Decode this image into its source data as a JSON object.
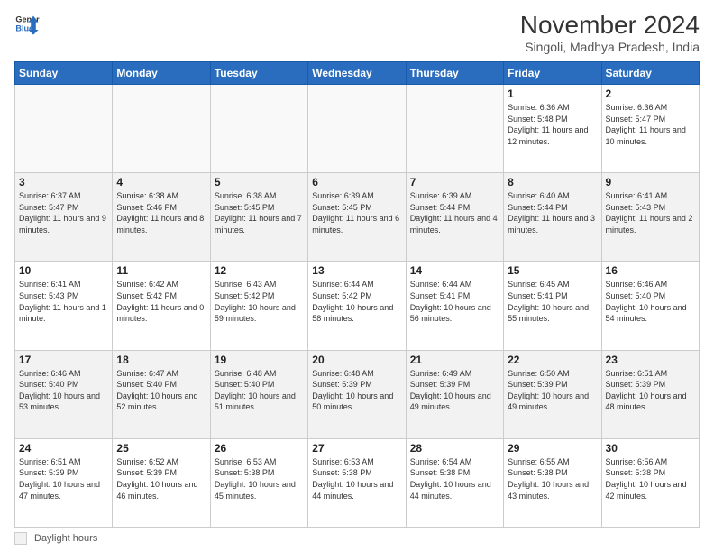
{
  "header": {
    "logo_line1": "General",
    "logo_line2": "Blue",
    "month_title": "November 2024",
    "subtitle": "Singoli, Madhya Pradesh, India"
  },
  "days_of_week": [
    "Sunday",
    "Monday",
    "Tuesday",
    "Wednesday",
    "Thursday",
    "Friday",
    "Saturday"
  ],
  "weeks": [
    [
      {
        "day": "",
        "info": ""
      },
      {
        "day": "",
        "info": ""
      },
      {
        "day": "",
        "info": ""
      },
      {
        "day": "",
        "info": ""
      },
      {
        "day": "",
        "info": ""
      },
      {
        "day": "1",
        "info": "Sunrise: 6:36 AM\nSunset: 5:48 PM\nDaylight: 11 hours and 12 minutes."
      },
      {
        "day": "2",
        "info": "Sunrise: 6:36 AM\nSunset: 5:47 PM\nDaylight: 11 hours and 10 minutes."
      }
    ],
    [
      {
        "day": "3",
        "info": "Sunrise: 6:37 AM\nSunset: 5:47 PM\nDaylight: 11 hours and 9 minutes."
      },
      {
        "day": "4",
        "info": "Sunrise: 6:38 AM\nSunset: 5:46 PM\nDaylight: 11 hours and 8 minutes."
      },
      {
        "day": "5",
        "info": "Sunrise: 6:38 AM\nSunset: 5:45 PM\nDaylight: 11 hours and 7 minutes."
      },
      {
        "day": "6",
        "info": "Sunrise: 6:39 AM\nSunset: 5:45 PM\nDaylight: 11 hours and 6 minutes."
      },
      {
        "day": "7",
        "info": "Sunrise: 6:39 AM\nSunset: 5:44 PM\nDaylight: 11 hours and 4 minutes."
      },
      {
        "day": "8",
        "info": "Sunrise: 6:40 AM\nSunset: 5:44 PM\nDaylight: 11 hours and 3 minutes."
      },
      {
        "day": "9",
        "info": "Sunrise: 6:41 AM\nSunset: 5:43 PM\nDaylight: 11 hours and 2 minutes."
      }
    ],
    [
      {
        "day": "10",
        "info": "Sunrise: 6:41 AM\nSunset: 5:43 PM\nDaylight: 11 hours and 1 minute."
      },
      {
        "day": "11",
        "info": "Sunrise: 6:42 AM\nSunset: 5:42 PM\nDaylight: 11 hours and 0 minutes."
      },
      {
        "day": "12",
        "info": "Sunrise: 6:43 AM\nSunset: 5:42 PM\nDaylight: 10 hours and 59 minutes."
      },
      {
        "day": "13",
        "info": "Sunrise: 6:44 AM\nSunset: 5:42 PM\nDaylight: 10 hours and 58 minutes."
      },
      {
        "day": "14",
        "info": "Sunrise: 6:44 AM\nSunset: 5:41 PM\nDaylight: 10 hours and 56 minutes."
      },
      {
        "day": "15",
        "info": "Sunrise: 6:45 AM\nSunset: 5:41 PM\nDaylight: 10 hours and 55 minutes."
      },
      {
        "day": "16",
        "info": "Sunrise: 6:46 AM\nSunset: 5:40 PM\nDaylight: 10 hours and 54 minutes."
      }
    ],
    [
      {
        "day": "17",
        "info": "Sunrise: 6:46 AM\nSunset: 5:40 PM\nDaylight: 10 hours and 53 minutes."
      },
      {
        "day": "18",
        "info": "Sunrise: 6:47 AM\nSunset: 5:40 PM\nDaylight: 10 hours and 52 minutes."
      },
      {
        "day": "19",
        "info": "Sunrise: 6:48 AM\nSunset: 5:40 PM\nDaylight: 10 hours and 51 minutes."
      },
      {
        "day": "20",
        "info": "Sunrise: 6:48 AM\nSunset: 5:39 PM\nDaylight: 10 hours and 50 minutes."
      },
      {
        "day": "21",
        "info": "Sunrise: 6:49 AM\nSunset: 5:39 PM\nDaylight: 10 hours and 49 minutes."
      },
      {
        "day": "22",
        "info": "Sunrise: 6:50 AM\nSunset: 5:39 PM\nDaylight: 10 hours and 49 minutes."
      },
      {
        "day": "23",
        "info": "Sunrise: 6:51 AM\nSunset: 5:39 PM\nDaylight: 10 hours and 48 minutes."
      }
    ],
    [
      {
        "day": "24",
        "info": "Sunrise: 6:51 AM\nSunset: 5:39 PM\nDaylight: 10 hours and 47 minutes."
      },
      {
        "day": "25",
        "info": "Sunrise: 6:52 AM\nSunset: 5:39 PM\nDaylight: 10 hours and 46 minutes."
      },
      {
        "day": "26",
        "info": "Sunrise: 6:53 AM\nSunset: 5:38 PM\nDaylight: 10 hours and 45 minutes."
      },
      {
        "day": "27",
        "info": "Sunrise: 6:53 AM\nSunset: 5:38 PM\nDaylight: 10 hours and 44 minutes."
      },
      {
        "day": "28",
        "info": "Sunrise: 6:54 AM\nSunset: 5:38 PM\nDaylight: 10 hours and 44 minutes."
      },
      {
        "day": "29",
        "info": "Sunrise: 6:55 AM\nSunset: 5:38 PM\nDaylight: 10 hours and 43 minutes."
      },
      {
        "day": "30",
        "info": "Sunrise: 6:56 AM\nSunset: 5:38 PM\nDaylight: 10 hours and 42 minutes."
      }
    ]
  ],
  "footer": {
    "daylight_label": "Daylight hours"
  }
}
